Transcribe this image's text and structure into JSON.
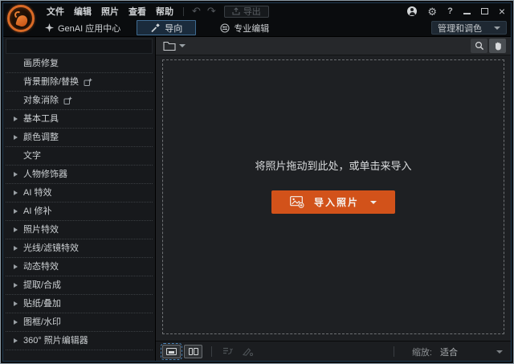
{
  "titlebar": {
    "menu_items": [
      "文件",
      "编辑",
      "照片",
      "查看",
      "帮助"
    ],
    "export_label": "导出",
    "icons": {
      "undo": "↶",
      "redo": "↷",
      "gear": "⚙",
      "help": "?",
      "close": "×"
    }
  },
  "modebar": {
    "genai_label": "GenAI 应用中心",
    "guided_tab": "导向",
    "pro_edit_label": "专业编辑",
    "manage_button": "管理和调色"
  },
  "sidebar": {
    "items": [
      {
        "label": "画质修复",
        "caret": false,
        "badge": false
      },
      {
        "label": "背景删除/替换",
        "caret": false,
        "badge": true
      },
      {
        "label": "对象消除",
        "caret": false,
        "badge": true
      },
      {
        "label": "基本工具",
        "caret": true,
        "badge": false
      },
      {
        "label": "颜色调整",
        "caret": true,
        "badge": false
      },
      {
        "label": "文字",
        "caret": false,
        "badge": false
      },
      {
        "label": "人物修饰器",
        "caret": true,
        "badge": false
      },
      {
        "label": "AI 特效",
        "caret": true,
        "badge": false
      },
      {
        "label": "AI 修补",
        "caret": true,
        "badge": false
      },
      {
        "label": "照片特效",
        "caret": true,
        "badge": false
      },
      {
        "label": "光线/滤镜特效",
        "caret": true,
        "badge": false
      },
      {
        "label": "动态特效",
        "caret": true,
        "badge": false
      },
      {
        "label": "提取/合成",
        "caret": true,
        "badge": false
      },
      {
        "label": "贴纸/叠加",
        "caret": true,
        "badge": false
      },
      {
        "label": "图框/水印",
        "caret": true,
        "badge": false
      },
      {
        "label": "360° 照片编辑器",
        "caret": true,
        "badge": false
      }
    ]
  },
  "main": {
    "dropzone_hint": "将照片拖动到此处，或单击来导入",
    "import_button": "导入照片"
  },
  "statusbar": {
    "zoom_label": "缩放:",
    "zoom_value": "适合"
  },
  "colors": {
    "accent_orange": "#d2521a",
    "tab_active_border": "#3e6a90",
    "selection_blue": "#4e86b8"
  }
}
